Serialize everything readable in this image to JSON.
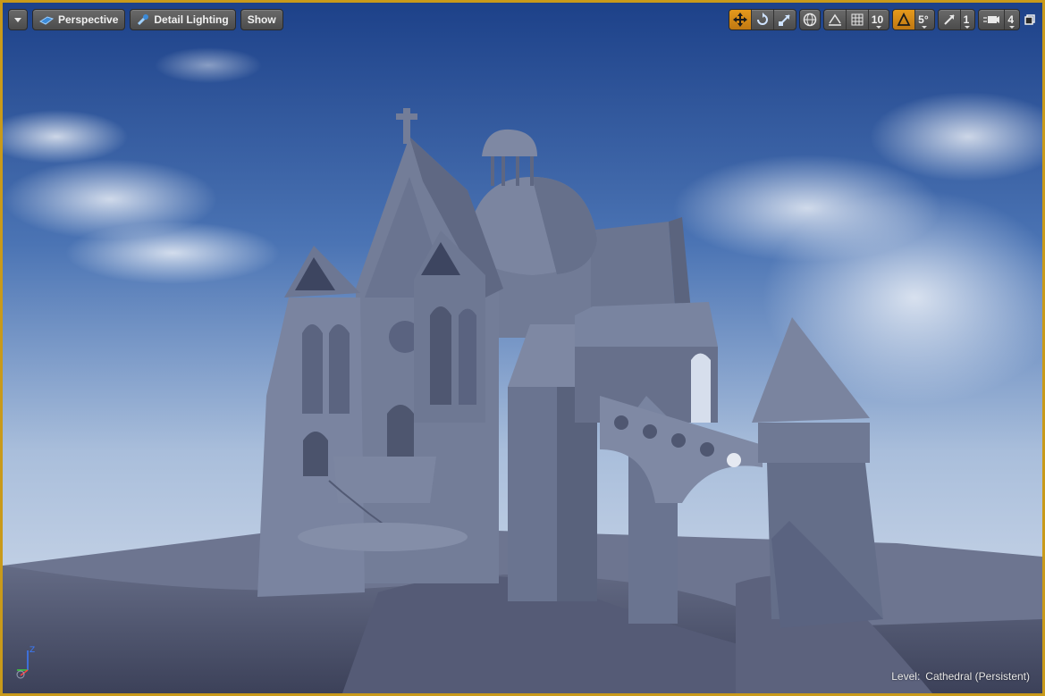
{
  "toolbar": {
    "options_menu": "viewport-options-menu",
    "view_mode": "Perspective",
    "lighting_mode": "Detail Lighting",
    "show_label": "Show",
    "grid_snap_value": "10",
    "rotation_snap_value": "5°",
    "scale_snap_value": "1",
    "camera_speed_value": "4"
  },
  "status": {
    "level_key": "Level:",
    "level_value": "Cathedral (Persistent)"
  },
  "colors": {
    "frame": "#c99a1a",
    "active": "#e59a1c"
  }
}
